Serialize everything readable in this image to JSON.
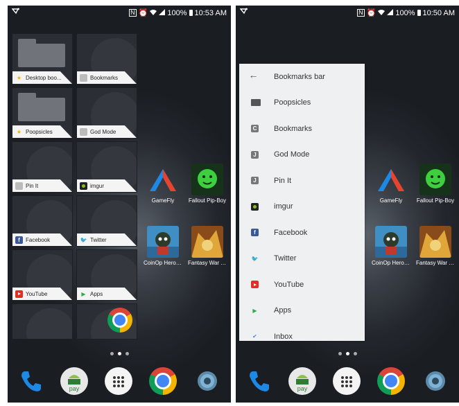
{
  "left": {
    "status": {
      "battery": "100%",
      "time": "10:53 AM"
    },
    "bookmark_tiles": [
      {
        "label": "Desktop boo...",
        "icon": "star-icon",
        "type": "folder"
      },
      {
        "label": "Bookmarks",
        "icon": "globe-icon",
        "type": "page"
      },
      {
        "label": "Poopsicles",
        "icon": "star-icon",
        "type": "folder"
      },
      {
        "label": "God Mode",
        "icon": "globe-icon",
        "type": "page"
      },
      {
        "label": "Pin It",
        "icon": "globe-icon",
        "type": "page"
      },
      {
        "label": "imgur",
        "icon": "imgur-icon",
        "type": "page"
      },
      {
        "label": "Facebook",
        "icon": "facebook-icon",
        "type": "page"
      },
      {
        "label": "Twitter",
        "icon": "twitter-icon",
        "type": "page"
      },
      {
        "label": "YouTube",
        "icon": "youtube-icon",
        "type": "page"
      },
      {
        "label": "Apps",
        "icon": "apps-icon",
        "type": "page"
      }
    ]
  },
  "right": {
    "status": {
      "battery": "100%",
      "time": "10:50 AM"
    },
    "bookmarks_panel": {
      "header": "Bookmarks bar",
      "items": [
        {
          "label": "Poopsicles",
          "icon": "folder-icon"
        },
        {
          "label": "Bookmarks",
          "icon": "letter-c-icon",
          "letter": "C"
        },
        {
          "label": "God Mode",
          "icon": "letter-j-icon",
          "letter": "J"
        },
        {
          "label": "Pin It",
          "icon": "letter-j-icon",
          "letter": "J"
        },
        {
          "label": "imgur",
          "icon": "imgur-icon"
        },
        {
          "label": "Facebook",
          "icon": "facebook-icon"
        },
        {
          "label": "Twitter",
          "icon": "twitter-icon"
        },
        {
          "label": "YouTube",
          "icon": "youtube-icon"
        },
        {
          "label": "Apps",
          "icon": "apps-icon"
        },
        {
          "label": "Inbox",
          "icon": "inbox-icon"
        }
      ]
    }
  },
  "home_apps": [
    "GameFly",
    "Fallout Pip-Boy",
    "CoinOp Heroes...",
    "Fantasy War T..."
  ],
  "dock": [
    {
      "name": "phone-icon"
    },
    {
      "name": "android-pay-icon",
      "label": "pay"
    },
    {
      "name": "app-drawer-icon"
    },
    {
      "name": "chrome-icon"
    },
    {
      "name": "settings-icon"
    }
  ],
  "colors": {
    "accent_blue": "#1e88e5",
    "chrome_red": "#db4437",
    "chrome_yellow": "#f4b400",
    "chrome_green": "#0f9d58"
  }
}
